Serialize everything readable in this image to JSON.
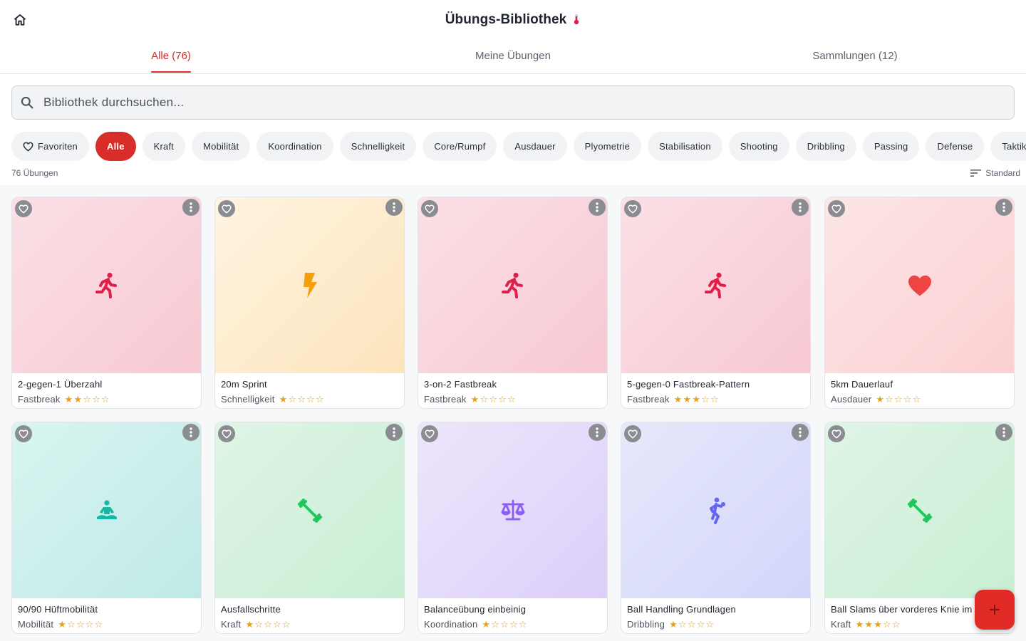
{
  "header": {
    "title": "Übungs-Bibliothek",
    "title_emoji": "🌡"
  },
  "tabs": [
    {
      "label": "Alle (76)",
      "active": true
    },
    {
      "label": "Meine Übungen",
      "active": false
    },
    {
      "label": "Sammlungen (12)",
      "active": false
    }
  ],
  "search": {
    "placeholder": "Bibliothek durchsuchen..."
  },
  "chips": {
    "favorites": "Favoriten",
    "items": [
      "Alle",
      "Kraft",
      "Mobilität",
      "Koordination",
      "Schnelligkeit",
      "Core/Rumpf",
      "Ausdauer",
      "Plyometrie",
      "Stabilisation",
      "Shooting",
      "Dribbling",
      "Passing",
      "Defense",
      "Taktik"
    ],
    "active_index": 0
  },
  "results": {
    "count_label": "76 Übungen",
    "sort_label": "Standard"
  },
  "colors": {
    "accent": "#d92d2a",
    "star": "#e6a319"
  },
  "exercises": [
    {
      "name": "2-gegen-1 Überzahl",
      "category": "Fastbreak",
      "rating": 2,
      "icon": "running-icon",
      "icon_color": "#e11d48",
      "bg": [
        "#fbe0e6",
        "#f7c9d3"
      ]
    },
    {
      "name": "20m Sprint",
      "category": "Schnelligkeit",
      "rating": 1,
      "icon": "bolt-icon",
      "icon_color": "#f59e0b",
      "bg": [
        "#fef4e0",
        "#fde4bd"
      ]
    },
    {
      "name": "3-on-2 Fastbreak",
      "category": "Fastbreak",
      "rating": 1,
      "icon": "running-icon",
      "icon_color": "#e11d48",
      "bg": [
        "#fbe0e6",
        "#f7c9d3"
      ]
    },
    {
      "name": "5-gegen-0 Fastbreak-Pattern",
      "category": "Fastbreak",
      "rating": 3,
      "icon": "running-icon",
      "icon_color": "#e11d48",
      "bg": [
        "#fbe0e6",
        "#f7c9d3"
      ]
    },
    {
      "name": "5km Dauerlauf",
      "category": "Ausdauer",
      "rating": 1,
      "icon": "heart-icon",
      "icon_color": "#ef4444",
      "bg": [
        "#fde6e6",
        "#fbd0d2"
      ]
    },
    {
      "name": "90/90 Hüftmobilität",
      "category": "Mobilität",
      "rating": 1,
      "icon": "meditation-icon",
      "icon_color": "#14b8a6",
      "bg": [
        "#d9f5f1",
        "#bfe9e6"
      ]
    },
    {
      "name": "Ausfallschritte",
      "category": "Kraft",
      "rating": 1,
      "icon": "dumbbell-icon",
      "icon_color": "#22c55e",
      "bg": [
        "#e0f5e6",
        "#c8eed4"
      ]
    },
    {
      "name": "Balanceübung einbeinig",
      "category": "Koordination",
      "rating": 1,
      "icon": "balance-scale-icon",
      "icon_color": "#8b5cf6",
      "bg": [
        "#ede6fb",
        "#dccffa"
      ]
    },
    {
      "name": "Ball Handling Grundlagen",
      "category": "Dribbling",
      "rating": 1,
      "icon": "basketball-player-icon",
      "icon_color": "#6366f1",
      "bg": [
        "#e6e8fb",
        "#d3d6fa"
      ]
    },
    {
      "name": "Ball Slams über vorderes Knie im Ausfallschritt",
      "category": "Kraft",
      "rating": 3,
      "icon": "dumbbell-icon",
      "icon_color": "#22c55e",
      "bg": [
        "#e0f5e6",
        "#c8eed4"
      ]
    }
  ],
  "fab": {
    "label": "+"
  }
}
